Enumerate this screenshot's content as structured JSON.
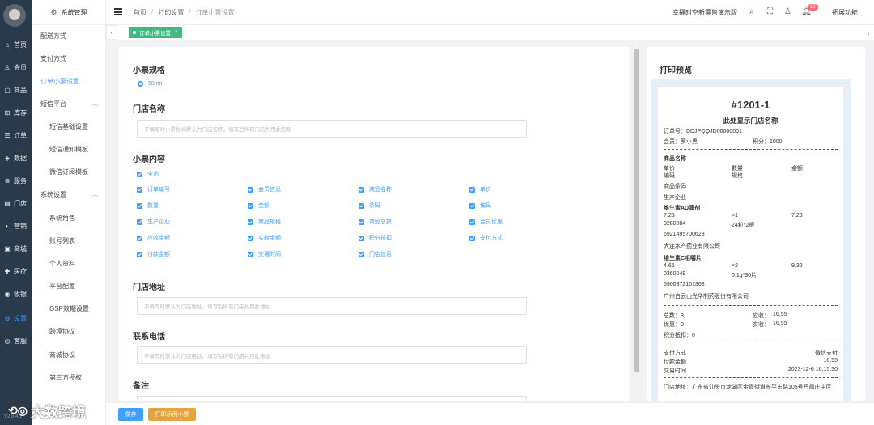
{
  "nav": {
    "items": [
      {
        "icon": "home-icon",
        "glyph": "⌂",
        "label": "首页"
      },
      {
        "icon": "member-icon",
        "glyph": "♙",
        "label": "会员"
      },
      {
        "icon": "product-icon",
        "glyph": "▢",
        "label": "商品"
      },
      {
        "icon": "inventory-icon",
        "glyph": "⊞",
        "label": "库存"
      },
      {
        "icon": "order-icon",
        "glyph": "☰",
        "label": "订单"
      },
      {
        "icon": "data-icon",
        "glyph": "◈",
        "label": "数据"
      },
      {
        "icon": "service-icon",
        "glyph": "⊗",
        "label": "服务"
      },
      {
        "icon": "store-icon",
        "glyph": "▤",
        "label": "门店"
      },
      {
        "icon": "marketing-icon",
        "glyph": "◐",
        "label": "营销"
      },
      {
        "icon": "mall-icon",
        "glyph": "▣",
        "label": "商城"
      },
      {
        "icon": "medical-icon",
        "glyph": "✚",
        "label": "医疗"
      },
      {
        "icon": "cashier-icon",
        "glyph": "◉",
        "label": "收银"
      },
      {
        "icon": "settings-icon",
        "glyph": "⚙",
        "label": "设置"
      },
      {
        "icon": "support-icon",
        "glyph": "◎",
        "label": "客服"
      }
    ],
    "active_index": 12,
    "version": "V2.8.4.1"
  },
  "submenu": {
    "header": "系统管理",
    "items": [
      {
        "label": "配送方式",
        "level": 1
      },
      {
        "label": "支付方式",
        "level": 1
      },
      {
        "label": "订单小票设置",
        "level": 1,
        "active": true
      },
      {
        "label": "短信平台",
        "level": 1,
        "expand": true
      },
      {
        "label": "短信基础设置",
        "level": 2
      },
      {
        "label": "短信通知模板",
        "level": 2
      },
      {
        "label": "微信订阅模板",
        "level": 2
      },
      {
        "label": "系统设置",
        "level": 1,
        "expand": true
      },
      {
        "label": "系统角色",
        "level": 2
      },
      {
        "label": "账号列表",
        "level": 2
      },
      {
        "label": "个人资料",
        "level": 2
      },
      {
        "label": "平台配置",
        "level": 2
      },
      {
        "label": "GSP效期设置",
        "level": 2
      },
      {
        "label": "跨境协议",
        "level": 2
      },
      {
        "label": "商城协议",
        "level": 2
      },
      {
        "label": "第三方授权",
        "level": 2
      }
    ]
  },
  "topbar": {
    "breadcrumb": [
      "首页",
      "打印设置",
      "订单小票设置"
    ],
    "store_name": "幸福时空新零售演示版",
    "notification_count": "22",
    "extension": "拓展功能"
  },
  "tabs": [
    {
      "label": "订单小票设置",
      "close": "×"
    }
  ],
  "form": {
    "spec_title": "小票规格",
    "spec_option": "58mm",
    "store_name_title": "门店名称",
    "store_name_placeholder": "不填写时小票抬头默认为门店名称，填写后所有门店共用此名称",
    "content_title": "小票内容",
    "select_all": "全选",
    "options": [
      [
        "订单编号",
        "会员信息",
        "商品名称",
        "单价"
      ],
      [
        "数量",
        "金额",
        "条码",
        "编码"
      ],
      [
        "生产企业",
        "商品规格",
        "商品总数",
        "会员优惠"
      ],
      [
        "应收金额",
        "实收金额",
        "积分抵扣",
        "支付方式"
      ],
      [
        "付款金额",
        "交易时间",
        "门店信息",
        ""
      ]
    ],
    "address_title": "门店地址",
    "address_placeholder": "不填写时默认为门店地址，填写后所有门店共用此地址",
    "phone_title": "联系电话",
    "phone_placeholder": "不填写时默认为门店电话，填写后所有门店共用此电话",
    "remark_title": "备注"
  },
  "preview": {
    "title": "打印预览",
    "receipt_no": "#1201-1",
    "store_name": "此处显示门店名称",
    "order_no": "订单号：DDJPQQJD00000001",
    "member": "会员：罗小黑",
    "points": "积分：1000",
    "goods_header": "商品名称",
    "col_price": "单价",
    "col_qty": "数量",
    "col_amount": "金额",
    "col_code": "编码",
    "col_spec": "规格",
    "col_barcode": "商品条码",
    "col_maker": "生产企业",
    "items": [
      {
        "name": "维生素AD滴剂",
        "price": "7.23",
        "qty": "×1",
        "amount": "7.23",
        "code": "0280084",
        "spec": "24粒*2板",
        "barcode": "6921495700623",
        "maker": "大连水产药业有限公司"
      },
      {
        "name": "维生素C咀嚼片",
        "price": "4.66",
        "qty": "×2",
        "amount": "9.32",
        "code": "0360049",
        "spec": "0.1g*30片",
        "barcode": "6900372161368",
        "maker": "广州白云山光华制药股份有限公司"
      }
    ],
    "total_count": "总数：3",
    "receivable": "应收：",
    "receivable_val": "16.55",
    "discount": "优惠：0",
    "paid": "实收：",
    "paid_val": "16.55",
    "points_deduct": "积分抵扣：0",
    "pay_method_label": "支付方式",
    "pay_method_val": "微信支付",
    "pay_amount_label": "付款金额",
    "pay_amount_val": "16.55",
    "trade_time_label": "交易时间",
    "trade_time_val": "2023-12-6 16:15:30",
    "address": "门店地址：广东省汕头市龙湖区金霞街道长平东路105号丹霞庄中区"
  },
  "buttons": {
    "save": "保存",
    "print_sample": "打印示例小票"
  },
  "colors": {
    "primary": "#409eff",
    "tab_green": "#42b983",
    "print_btn": "#e6a23c",
    "nav_bg": "#2b3a4a"
  },
  "watermark": "大数跨境"
}
